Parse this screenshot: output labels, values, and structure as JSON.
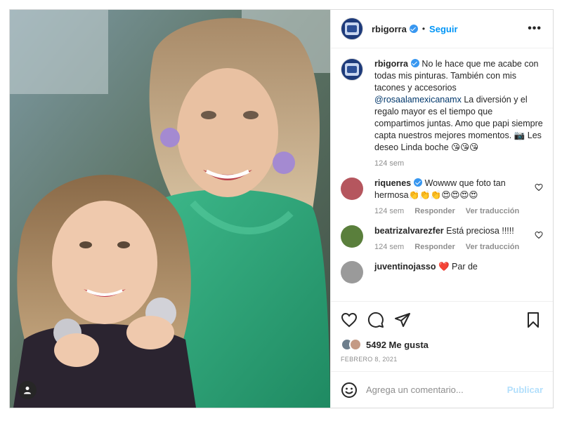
{
  "post": {
    "username": "rbigorra",
    "follow_label": "Seguir",
    "dot": "•",
    "more": "•••",
    "caption_pre": "No le hace que me acabe con todas mis pinturas. También con mis tacones y accesorios ",
    "caption_mention": "@rosaalamexicanamx",
    "caption_post": " La diversión y el regalo mayor es el tiempo que compartimos juntas. Amo que papi siempre capta nuestros mejores momentos. 📷 Les deseo Linda boche 😘😘😘",
    "caption_time": "124 sem"
  },
  "comments": [
    {
      "username": "riquenes",
      "text": " Wowww que foto tan hermosa👏👏👏😍😍😍😍",
      "time": "124 sem",
      "reply": "Responder",
      "translate": "Ver traducción",
      "avatar_color": "#b5565e"
    },
    {
      "username": "beatrizalvarezfer",
      "text": " Está preciosa !!!!!",
      "time": "124 sem",
      "reply": "Responder",
      "translate": "Ver traducción",
      "avatar_color": "#5a7f3c"
    },
    {
      "username": "juventinojasso",
      "text": " ❤️ Par de",
      "avatar_color": "#9a9a9a"
    }
  ],
  "likes": {
    "count": "5492 Me gusta",
    "date": "FEBRERO 8, 2021"
  },
  "add_comment": {
    "placeholder": "Agrega un comentario...",
    "publish": "Publicar"
  },
  "colors": {
    "link": "#0095f6",
    "muted": "#8e8e8e",
    "dress": "#2fa37a"
  },
  "icons": [
    "heart-icon",
    "comment-icon",
    "share-icon",
    "save-icon",
    "emoji-icon",
    "user-tag-icon",
    "verified-icon",
    "more-icon"
  ]
}
